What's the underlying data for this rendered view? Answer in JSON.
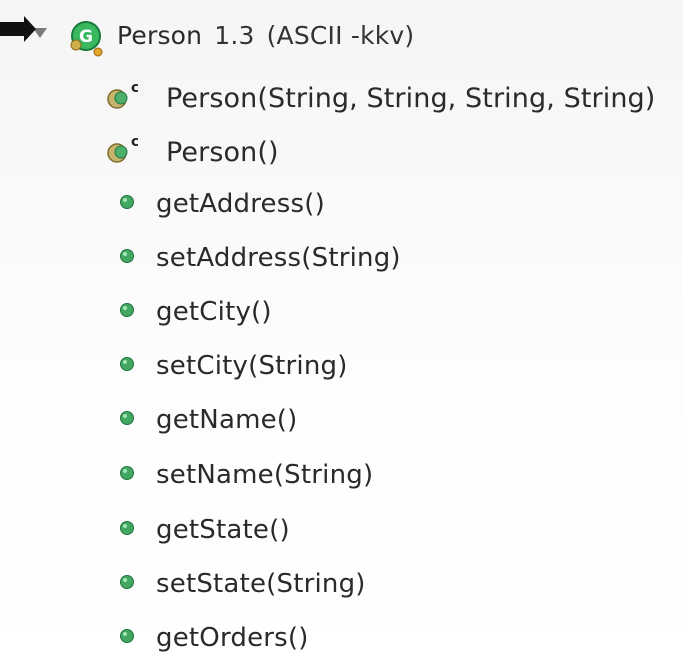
{
  "outline": {
    "class_name": "Person",
    "class_version": "1.3",
    "class_author": "(ASCII -kkv)",
    "constructor_badge": "c",
    "method_icon_color": "#22a45a",
    "items": [
      {
        "label": "Person(String, String, String, String)"
      },
      {
        "label": "Person()"
      },
      {
        "label": "getAddress()"
      },
      {
        "label": "setAddress(String)"
      },
      {
        "label": "getCity()"
      },
      {
        "label": "setCity(String)"
      },
      {
        "label": "getName()"
      },
      {
        "label": "setName(String)"
      },
      {
        "label": "getState()"
      },
      {
        "label": "setState(String)"
      },
      {
        "label": "getOrders()"
      }
    ]
  }
}
